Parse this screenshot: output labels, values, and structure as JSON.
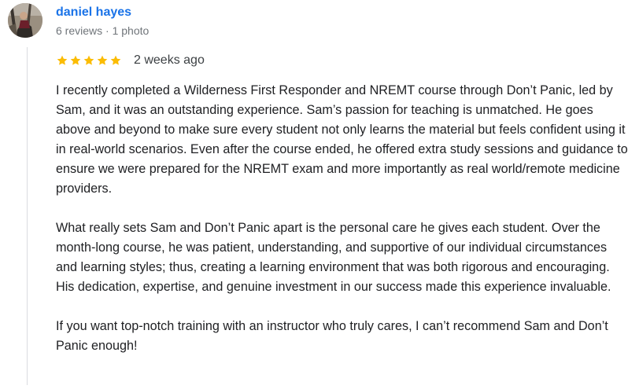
{
  "reviewer": {
    "name": "daniel hayes",
    "meta": "6 reviews · 1 photo"
  },
  "review": {
    "rating": 5,
    "rating_max": 5,
    "star_color": "#fbbc04",
    "date": "2 weeks ago",
    "paragraphs": [
      "I recently completed a Wilderness First Responder and NREMT course through Don’t Panic, led by Sam, and it was an outstanding experience. Sam’s passion for teaching is unmatched. He goes above and beyond to make sure every student not only learns the material but feels confident using it in real-world scenarios. Even after the course ended, he offered extra study sessions and guidance to ensure we were prepared for the NREMT exam and more importantly as real world/remote medicine providers.",
      "What really sets Sam and Don’t Panic apart is the personal care he gives each student. Over the month-long course, he was patient, understanding, and supportive of our individual circumstances and learning styles; thus, creating a learning environment that was both rigorous and encouraging. His dedication, expertise, and genuine investment in our success made this experience invaluable.",
      "If you want top-notch training with an instructor who truly cares, I can’t recommend Sam and Don’t Panic enough!"
    ]
  },
  "theme": {
    "name_color": "#1a73e8",
    "meta_color": "#70757a",
    "text_color": "#202124"
  }
}
